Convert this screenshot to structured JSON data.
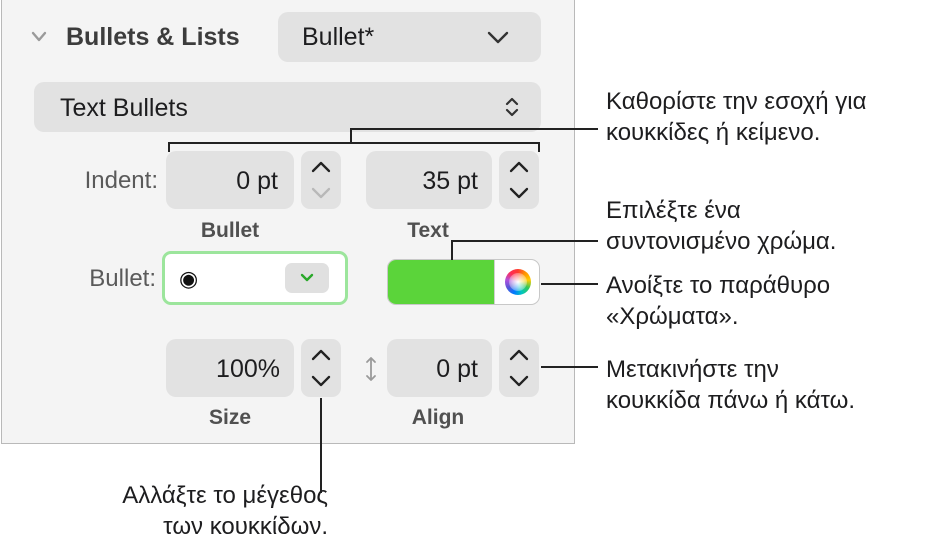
{
  "section": {
    "title": "Bullets & Lists",
    "style_value": "Bullet*",
    "type_value": "Text Bullets"
  },
  "indent": {
    "label": "Indent:",
    "bullet_value": "0 pt",
    "text_value": "35 pt",
    "bullet_caption": "Bullet",
    "text_caption": "Text"
  },
  "bullet": {
    "label": "Bullet:",
    "glyph": "◉",
    "color_swatch": "#5bd43a"
  },
  "size_align": {
    "size_value": "100%",
    "size_caption": "Size",
    "align_value": "0 pt",
    "align_caption": "Align"
  },
  "callouts": {
    "indent_line1": "Καθορίστε την εσοχή για",
    "indent_line2": "κουκκίδες ή κείμενο.",
    "color_line1": "Επιλέξτε ένα",
    "color_line2": "συντονισμένο χρώμα.",
    "wheel_line1": "Ανοίξτε το παράθυρο",
    "wheel_line2": "«Χρώματα».",
    "align_line1": "Μετακινήστε την",
    "align_line2": "κουκκίδα πάνω ή κάτω.",
    "size_line1": "Αλλάξτε το μέγεθος",
    "size_line2": "των κουκκίδων."
  }
}
